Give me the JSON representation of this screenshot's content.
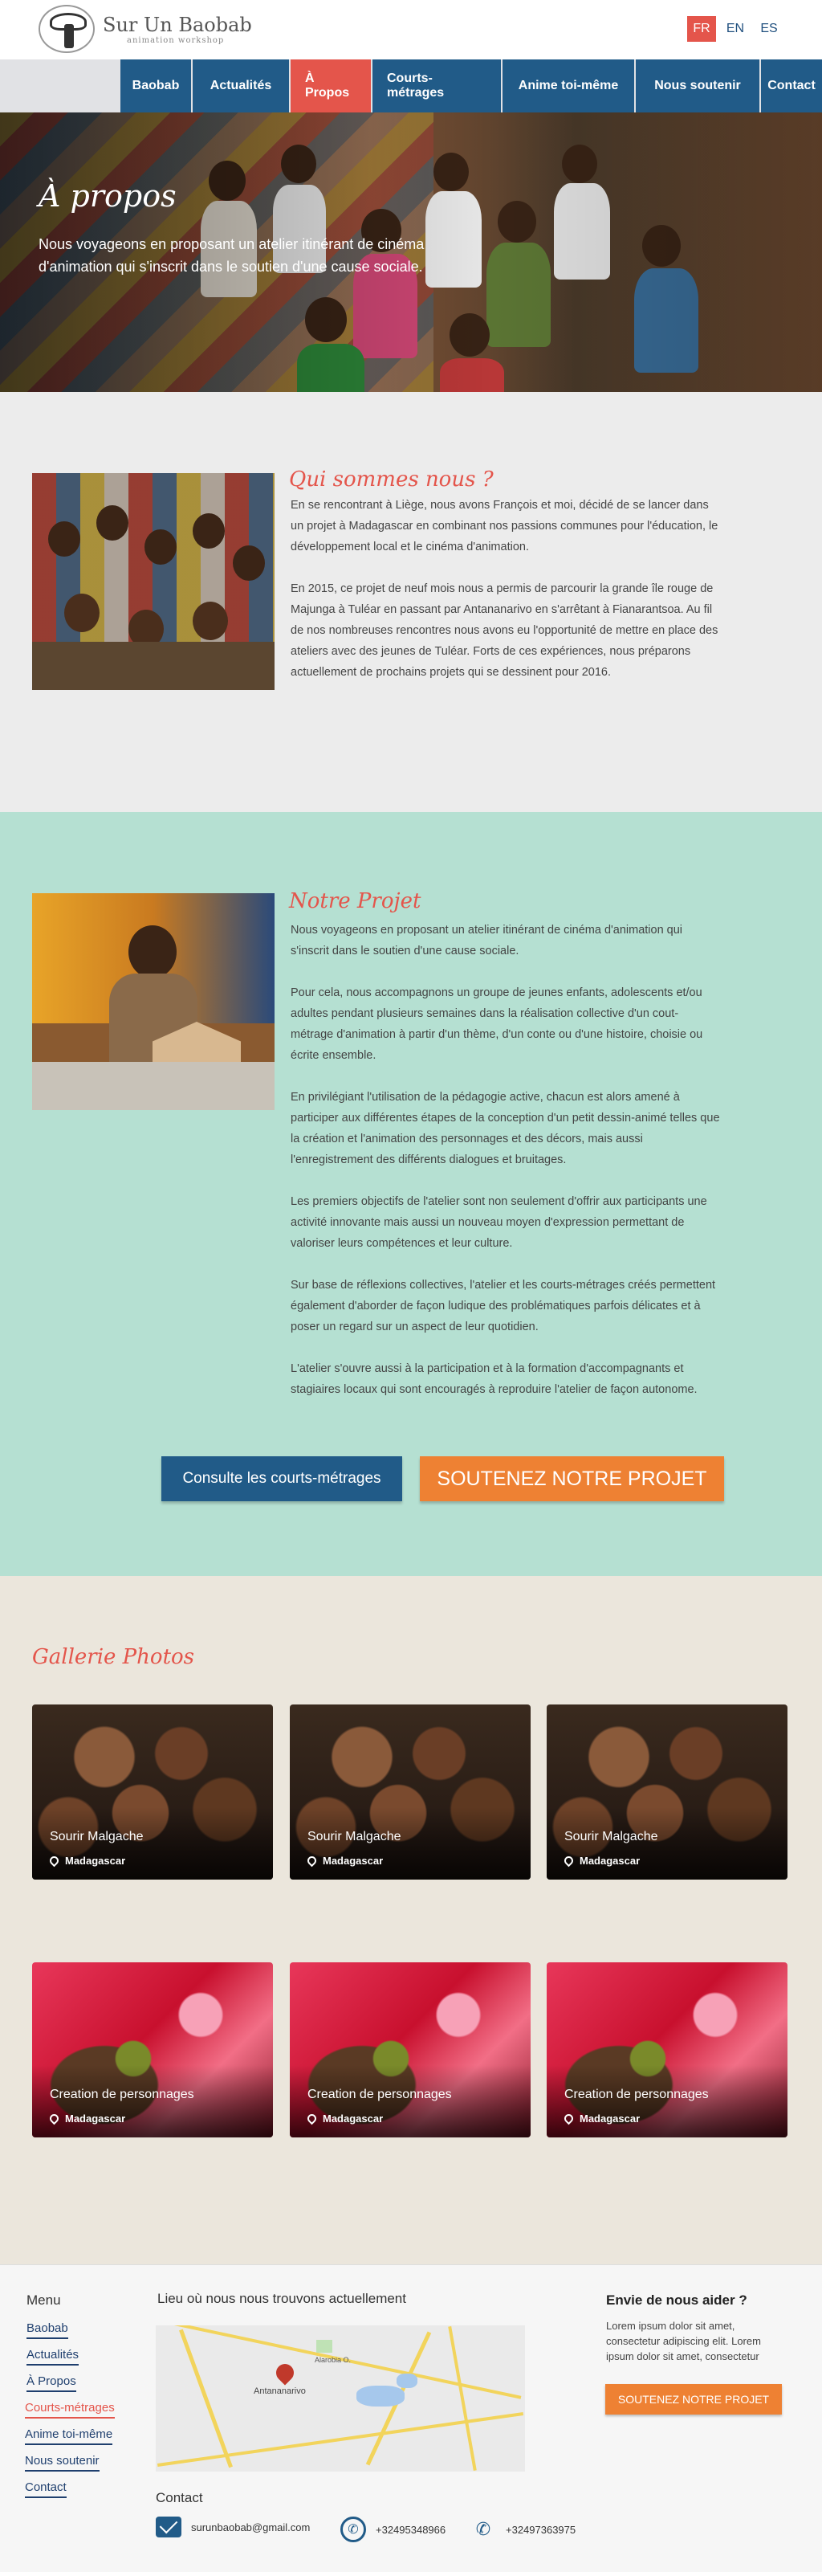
{
  "header": {
    "logo_title": "Sur Un Baobab",
    "logo_subtitle": "animation workshop",
    "languages": [
      "FR",
      "EN",
      "ES"
    ],
    "active_language": "FR"
  },
  "nav": {
    "items": [
      "Baobab",
      "Actualités",
      "À Propos",
      "Courts-métrages",
      "Anime toi-même",
      "Nous soutenir",
      "Contact"
    ],
    "active": "À Propos"
  },
  "hero": {
    "title": "À propos",
    "subtitle": "Nous voyageons en proposant un atelier itinérant de cinéma d'animation qui s'inscrit dans le soutien d'une cause sociale."
  },
  "about": {
    "title": "Qui sommes nous ?",
    "paragraphs": [
      "En se rencontrant à Liège, nous avons François et moi, décidé de se lancer dans un projet à Madagascar en combinant nos passions communes pour l'éducation, le développement local et le cinéma d'animation.",
      "En 2015, ce projet de neuf mois nous a permis de parcourir la grande île rouge de Majunga à Tuléar en passant par Antananarivo en s'arrêtant à Fianarantsoa. Au fil de nos nombreuses rencontres nous avons eu l'opportunité de mettre en place des ateliers avec des jeunes de Tuléar. Forts de ces expériences, nous préparons actuellement de prochains projets qui se dessinent pour 2016."
    ]
  },
  "project": {
    "title": "Notre Projet",
    "paragraphs": [
      "Nous voyageons en proposant un atelier itinérant de cinéma d'animation qui s'inscrit dans le soutien d'une cause sociale.",
      "Pour cela, nous accompagnons un groupe de jeunes enfants, adolescents et/ou adultes pendant plusieurs semaines dans la réalisation collective d'un cout-métrage d'animation à partir d'un thème, d'un conte ou d'une histoire, choisie ou écrite ensemble.",
      "En privilégiant l'utilisation de la pédagogie active, chacun est alors amené à participer aux différentes étapes de la conception d'un petit dessin-animé telles que la création et l'animation des personnages et des décors, mais aussi l'enregistrement des différents dialogues et bruitages.",
      "Les premiers objectifs de l'atelier sont non seulement d'offrir aux participants une activité innovante mais aussi un nouveau moyen d'expression permettant de valoriser leurs compétences et leur culture.",
      "Sur base de réflexions collectives, l'atelier et les courts-métrages créés permettent également d'aborder de façon ludique des problématiques parfois délicates et à poser un regard sur un aspect de leur quotidien.",
      "L'atelier s'ouvre aussi à la participation et à la formation d'accompagnants et stagiaires locaux qui sont encouragés à reproduire l'atelier de façon autonome."
    ],
    "btn_films": "Consulte les courts-métrages",
    "btn_support": "SOUTENEZ NOTRE PROJET"
  },
  "gallery": {
    "title": "Gallerie Photos",
    "cards": [
      {
        "title": "Sourir Malgache",
        "location": "Madagascar"
      },
      {
        "title": "Sourir Malgache",
        "location": "Madagascar"
      },
      {
        "title": "Sourir Malgache",
        "location": "Madagascar"
      },
      {
        "title": "Creation de personnages",
        "location": "Madagascar"
      },
      {
        "title": "Creation de personnages",
        "location": "Madagascar"
      },
      {
        "title": "Creation de personnages",
        "location": "Madagascar"
      }
    ]
  },
  "footer": {
    "menu_title": "Menu",
    "menu_items": [
      "Baobab",
      "Actualités",
      "À Propos",
      "Courts-métrages",
      "Anime toi-même",
      "Nous soutenir",
      "Contact"
    ],
    "menu_active": "Courts-métrages",
    "location_title": "Lieu où nous nous trouvons actuellement",
    "map_city": "Antananarivo",
    "map_district": "Alarobia O.",
    "contact_title": "Contact",
    "email": "surunbaobab@gmail.com",
    "whatsapp": "+32495348966",
    "phone": "+32497363975",
    "help_title": "Envie de nous aider ?",
    "help_text": "Lorem ipsum dolor sit amet, consectetur adipiscing elit. Lorem ipsum dolor sit amet, consectetur",
    "help_button": "SOUTENEZ NOTRE PROJET"
  },
  "colors": {
    "nav_blue": "#215b88",
    "accent_red": "#e4554b",
    "accent_orange": "#ee8133",
    "project_bg": "#b5e0d2",
    "gallery_bg": "#ebe6dc"
  }
}
